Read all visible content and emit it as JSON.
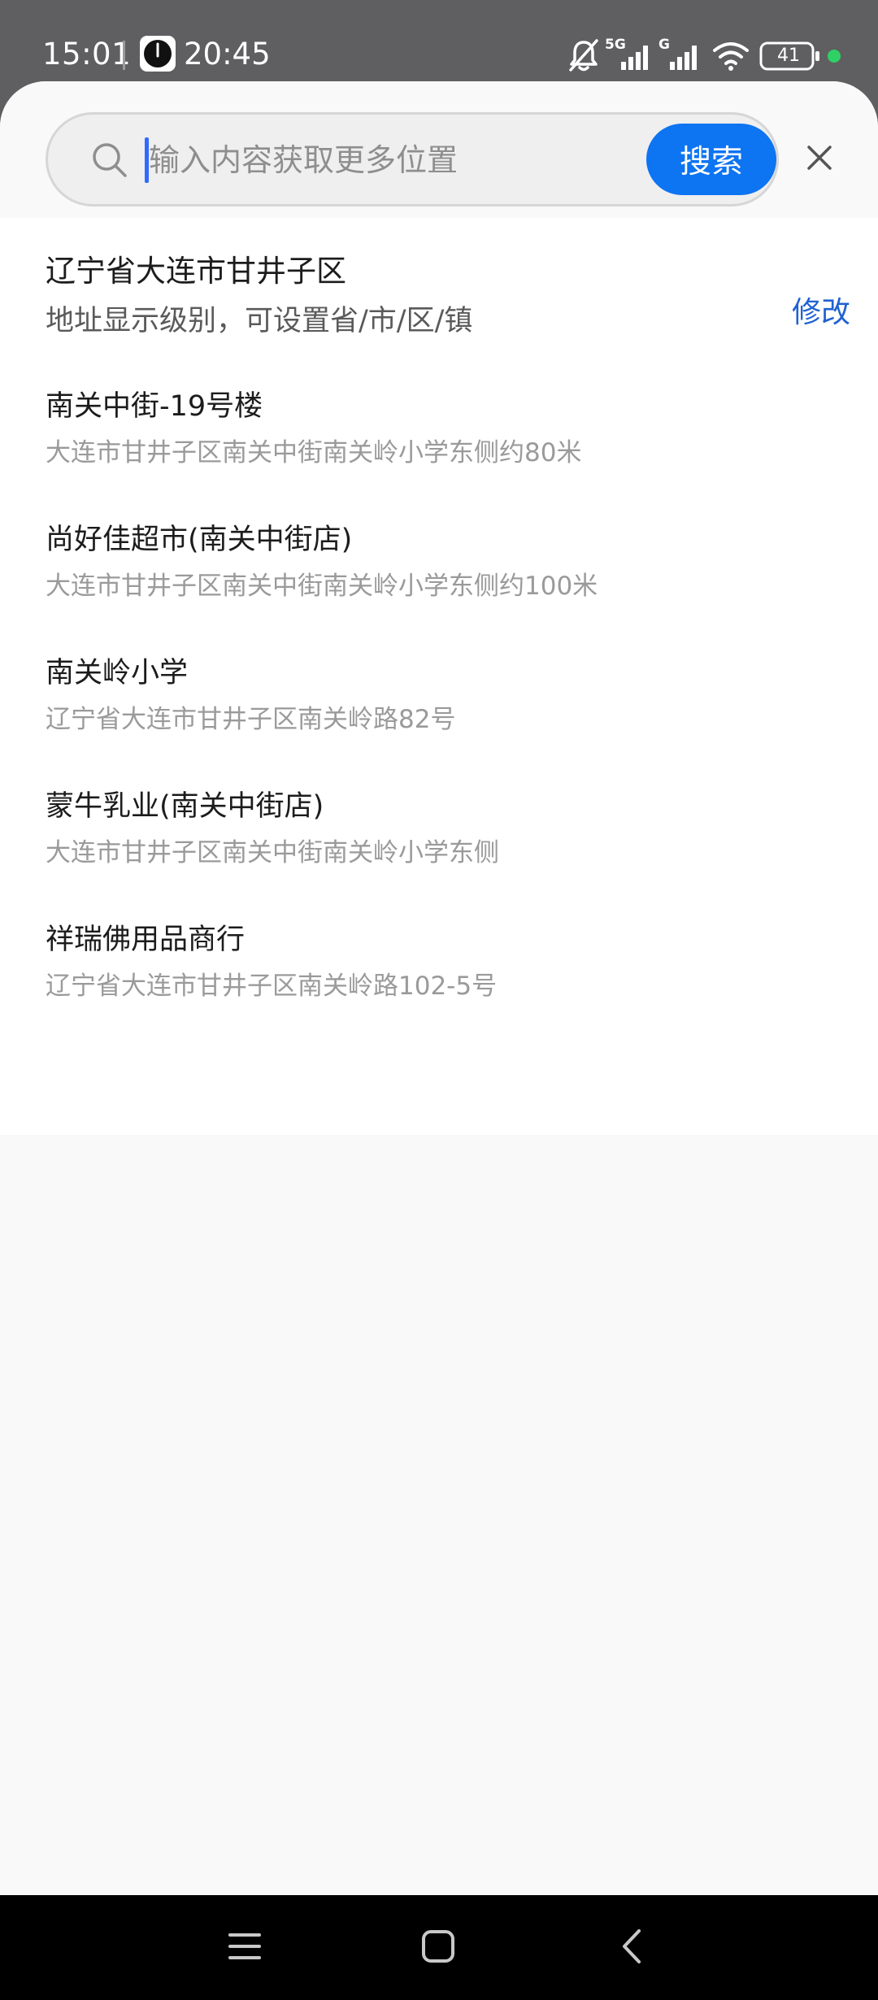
{
  "status_bar": {
    "time": "15:01",
    "clock_widget_time": "20:45",
    "network_1": "5G",
    "network_2": "G",
    "battery_level": "41"
  },
  "search": {
    "placeholder": "输入内容获取更多位置",
    "value": "",
    "button_label": "搜索"
  },
  "current_location": {
    "title": "辽宁省大连市甘井子区",
    "subtitle": "地址显示级别，可设置省/市/区/镇",
    "edit_label": "修改"
  },
  "places": [
    {
      "name": "南关中街-19号楼",
      "address": "大连市甘井子区南关中街南关岭小学东侧约80米"
    },
    {
      "name": "尚好佳超市(南关中街店)",
      "address": "大连市甘井子区南关中街南关岭小学东侧约100米"
    },
    {
      "name": "南关岭小学",
      "address": "辽宁省大连市甘井子区南关岭路82号"
    },
    {
      "name": "蒙牛乳业(南关中街店)",
      "address": "大连市甘井子区南关中街南关岭小学东侧"
    },
    {
      "name": "祥瑞佛用品商行",
      "address": "辽宁省大连市甘井子区南关岭路102-5号"
    }
  ],
  "colors": {
    "accent": "#0d74f2",
    "link": "#1f62d1",
    "status_dot": "#2fd064"
  },
  "icons": {
    "search": "search-icon",
    "close": "close-icon",
    "menu": "menu-icon",
    "home": "home-icon",
    "back": "back-icon"
  }
}
